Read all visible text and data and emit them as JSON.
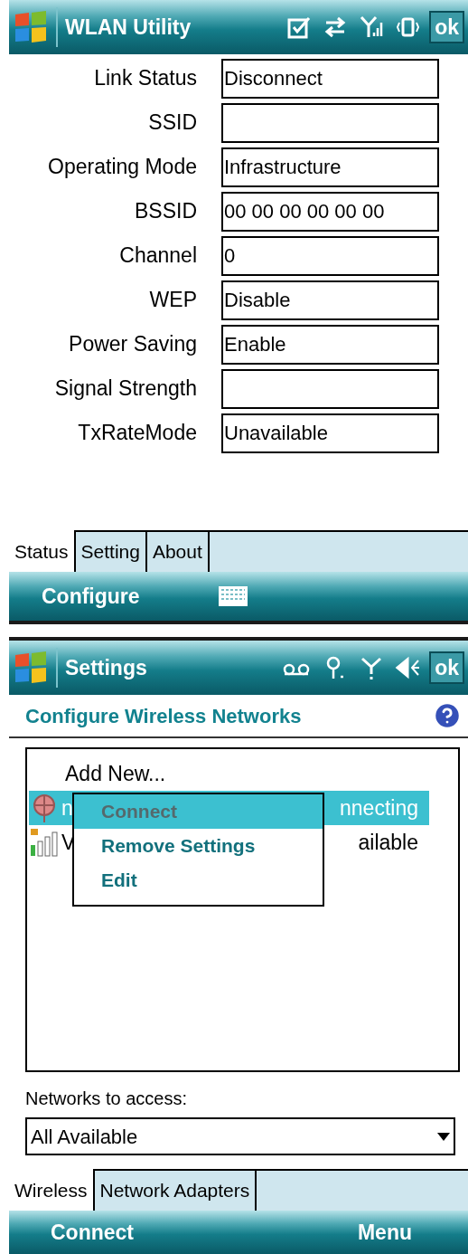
{
  "wlan_utility": {
    "title_bar": {
      "title": "WLAN Utility",
      "ok": "ok"
    },
    "fields": [
      {
        "label": "Link Status",
        "value": "Disconnect"
      },
      {
        "label": "SSID"
      },
      {
        "label": "Operating Mode",
        "value": "Infrastructure"
      },
      {
        "label": "BSSID",
        "value": "00 00 00 00 00 00"
      },
      {
        "label": "Channel",
        "value": "0"
      },
      {
        "label": "WEP",
        "value": "Disable"
      },
      {
        "label": "Power Saving",
        "value": "Enable"
      },
      {
        "label": "Signal Strength"
      },
      {
        "label": "TxRateMode",
        "value": "Unavailable"
      }
    ],
    "tabs": [
      {
        "label": "Status",
        "selected": true
      },
      {
        "label": "Setting",
        "selected": false
      },
      {
        "label": "About",
        "selected": false
      }
    ],
    "soft_keys": {
      "left": "Configure"
    }
  },
  "settings": {
    "title_bar": {
      "title": "Settings",
      "ok": "ok"
    },
    "header": "Configure Wireless Networks",
    "network_list": {
      "add_new": "Add New...",
      "items": [
        {
          "kind": "connecting",
          "text_start": "n",
          "text_end": "nnecting",
          "selected": true
        },
        {
          "kind": "secured",
          "text_start": "V",
          "text_end": "ailable",
          "selected": false
        }
      ]
    },
    "context_menu": [
      {
        "label": "Connect",
        "selected": true,
        "disabled": true
      },
      {
        "label": "Remove Settings",
        "selected": false,
        "disabled": false
      },
      {
        "label": "Edit",
        "selected": false,
        "disabled": false
      }
    ],
    "networks_to_access": {
      "label": "Networks to access:",
      "value": "All Available"
    },
    "tabs": [
      {
        "label": "Wireless",
        "selected": true
      },
      {
        "label": "Network Adapters",
        "selected": false
      }
    ],
    "soft_keys": {
      "left": "Connect",
      "right": "Menu"
    }
  }
}
